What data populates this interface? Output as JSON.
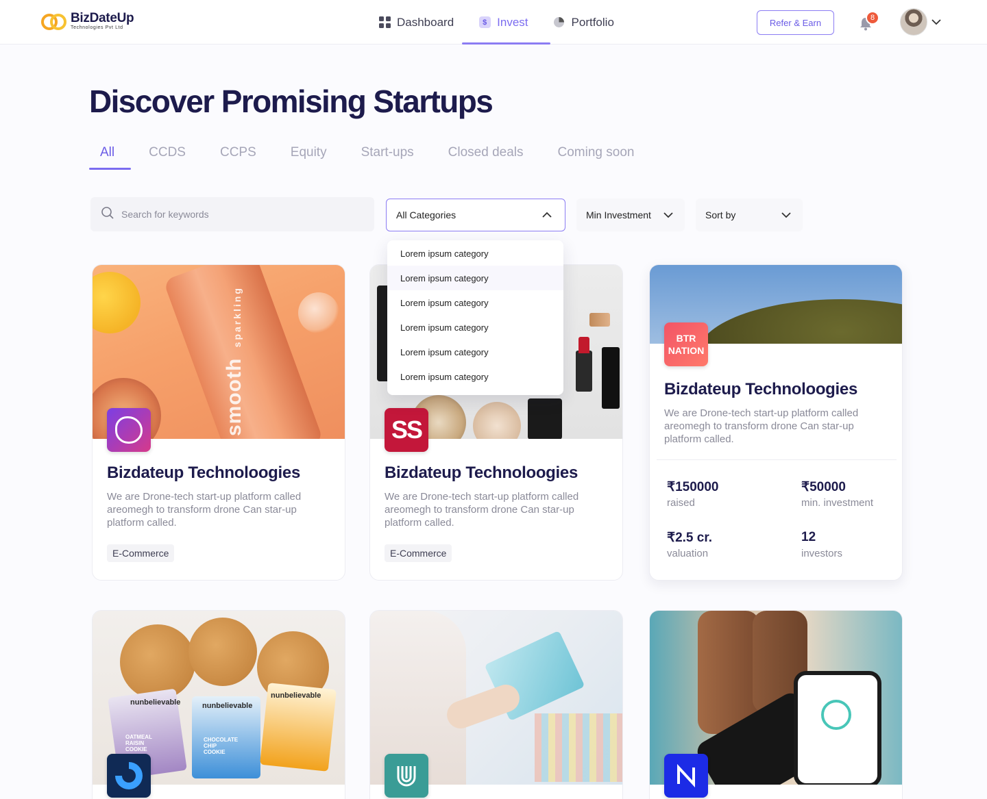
{
  "brand": {
    "name": "BizDateUp",
    "subtitle": "Technologies Pvt Ltd"
  },
  "nav": {
    "items": [
      {
        "label": "Dashboard",
        "icon": "grid-icon"
      },
      {
        "label": "Invest",
        "icon": "dollar-icon",
        "active": true
      },
      {
        "label": "Portfolio",
        "icon": "pie-chart-icon"
      }
    ]
  },
  "header": {
    "refer_label": "Refer & Earn",
    "notification_count": "8",
    "accent": "#7b6cf0",
    "badge_color": "#ee5a3b"
  },
  "page": {
    "title": "Discover Promising Startups"
  },
  "tabs": [
    "All",
    "CCDS",
    "CCPS",
    "Equity",
    "Start-ups",
    "Closed deals",
    "Coming soon"
  ],
  "filters": {
    "search_placeholder": "Search for keywords",
    "category_selected": "All Categories",
    "min_investment": "Min Investment",
    "sort_by": "Sort by"
  },
  "category_options": [
    "Lorem ipsum category",
    "Lorem ipsum category",
    "Lorem ipsum category",
    "Lorem ipsum category",
    "Lorem ipsum category",
    "Lorem ipsum category"
  ],
  "cards": [
    {
      "title": "Bizdateup Technoloogies",
      "description": "We are Drone-tech start-up platform called areomegh to transform drone Can star-up platform called.",
      "tag": "E-Commerce",
      "image_text": "smooth",
      "image_subtext": "sparkling"
    },
    {
      "title": "Bizdateup Technoloogies",
      "description": "We are Drone-tech start-up platform called areomegh to transform drone Can star-up platform called.",
      "tag": "E-Commerce",
      "logo_text": "SS"
    },
    {
      "title": "Bizdateup Technoloogies",
      "description": "We are Drone-tech start-up platform called areomegh to transform drone Can star-up platform called.",
      "logo_text": "BTR NATION",
      "stats": [
        {
          "value": "₹150000",
          "label": "raised"
        },
        {
          "value": "₹50000",
          "label": "min. investment"
        },
        {
          "value": "₹2.5 cr.",
          "label": "valuation"
        },
        {
          "value": "12",
          "label": "investors"
        }
      ]
    },
    {
      "image_text": "nunbelievable",
      "pack_1": "OATMEAL RAISIN COOKIE",
      "pack_2": "CHOCOLATE CHIP COOKIE"
    },
    {},
    {}
  ]
}
